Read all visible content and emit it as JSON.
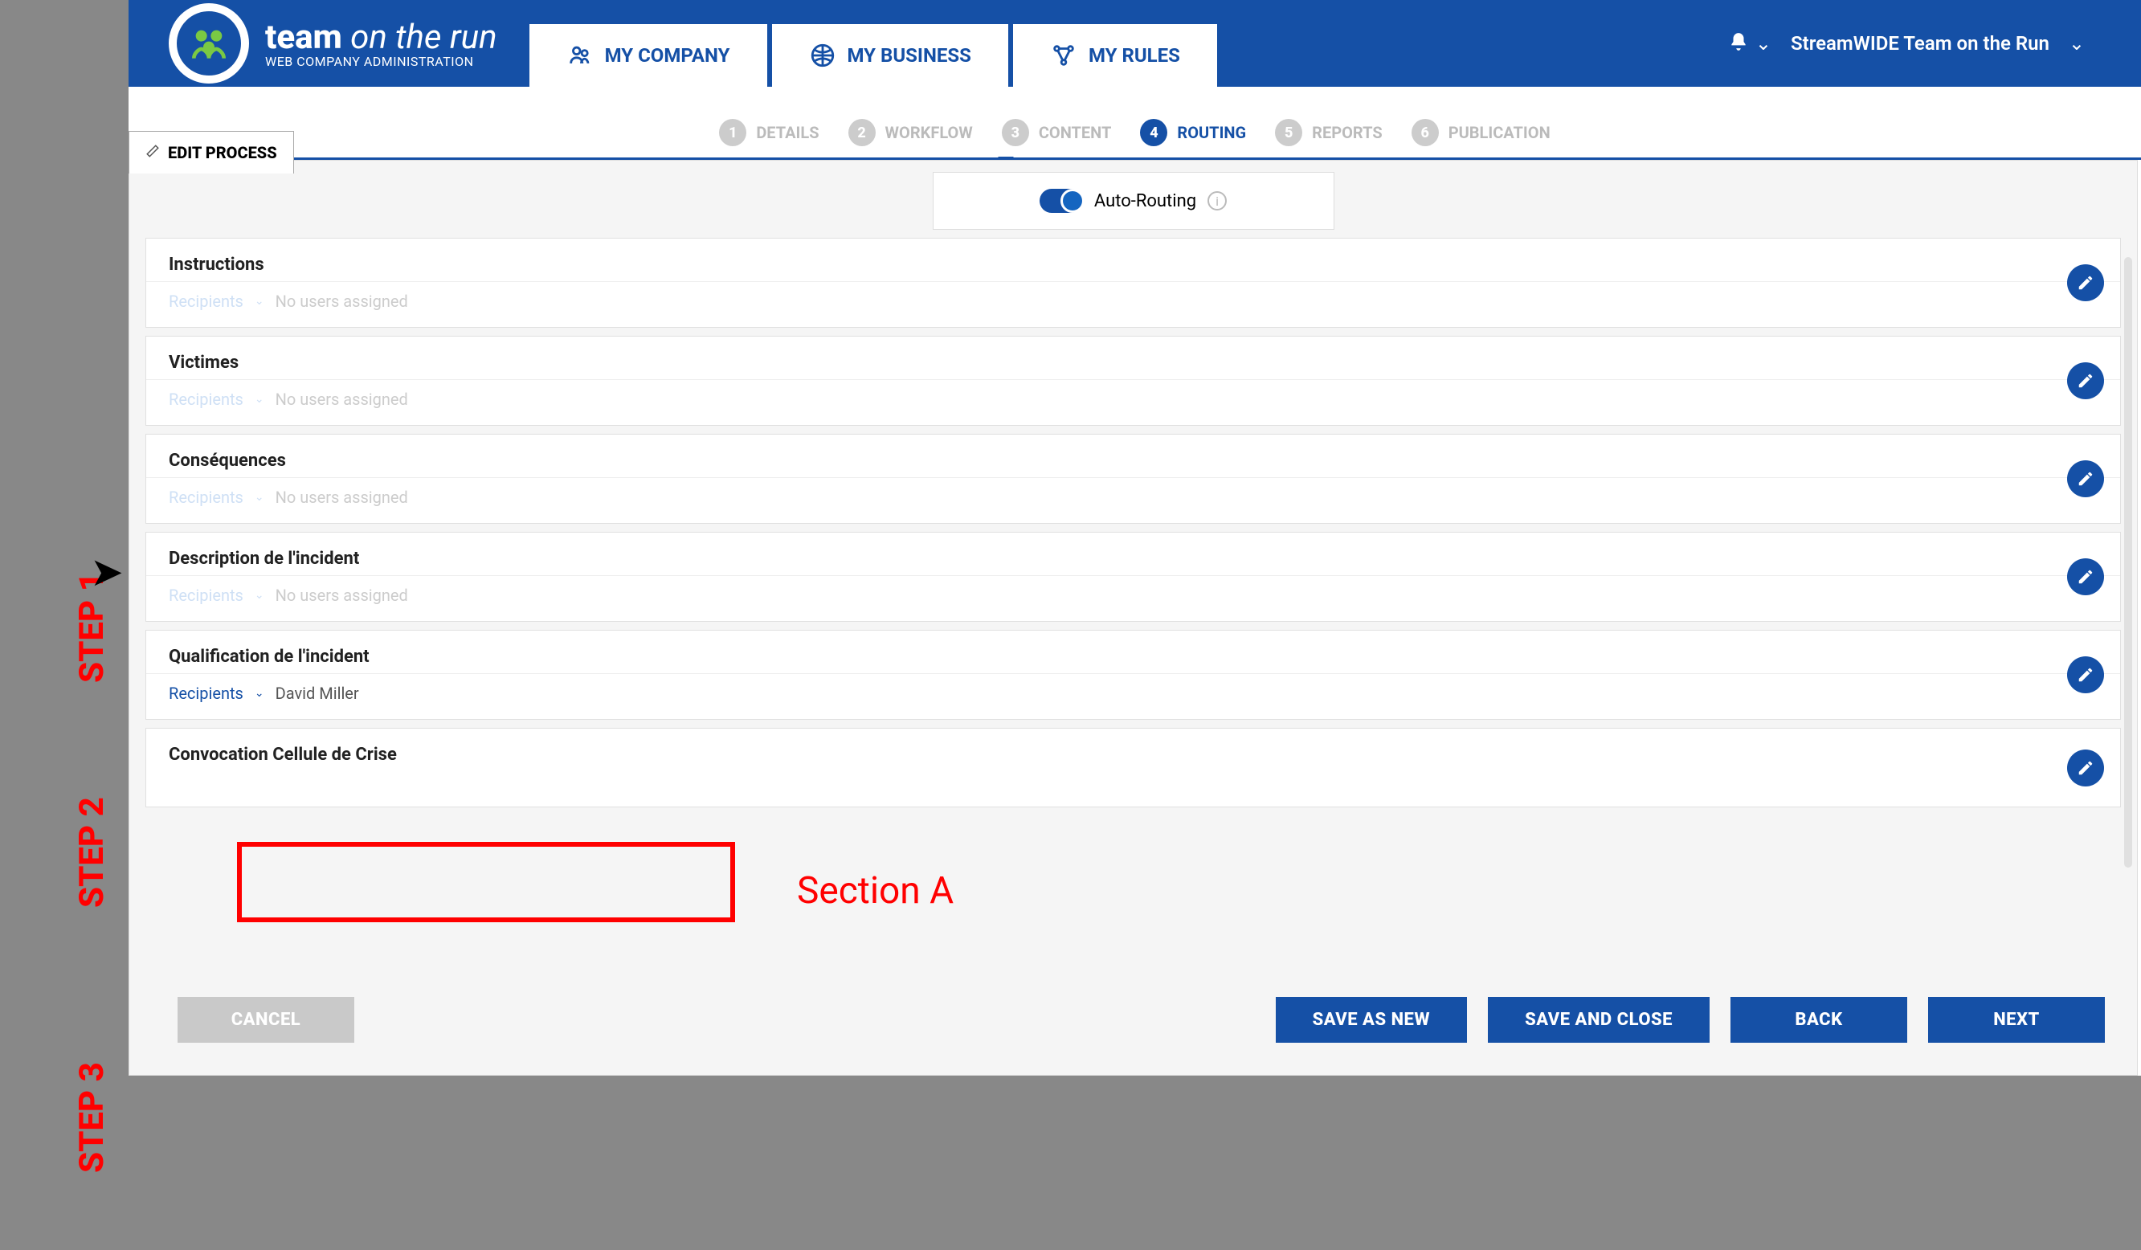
{
  "brand": {
    "title_bold": "team",
    "title_rest": " on the run",
    "subtitle": "WEB COMPANY ADMINISTRATION"
  },
  "nav": {
    "tabs": [
      "MY COMPANY",
      "MY BUSINESS",
      "MY RULES"
    ]
  },
  "user": {
    "company": "StreamWIDE Team on the Run"
  },
  "edit_tab": "EDIT PROCESS",
  "steps": [
    {
      "num": "1",
      "label": "DETAILS"
    },
    {
      "num": "2",
      "label": "WORKFLOW"
    },
    {
      "num": "3",
      "label": "CONTENT"
    },
    {
      "num": "4",
      "label": "ROUTING"
    },
    {
      "num": "5",
      "label": "REPORTS"
    },
    {
      "num": "6",
      "label": "PUBLICATION"
    }
  ],
  "active_step": 4,
  "auto_routing_label": "Auto-Routing",
  "recipients_label": "Recipients",
  "no_users": "No users assigned",
  "cards": [
    {
      "title": "Instructions",
      "value": "No users assigned",
      "active": false
    },
    {
      "title": "Victimes",
      "value": "No users assigned",
      "active": false
    },
    {
      "title": "Conséquences",
      "value": "No users assigned",
      "active": false
    },
    {
      "title": "Description de l'incident",
      "value": "No users assigned",
      "active": false
    },
    {
      "title": "Qualification de l'incident",
      "value": "David Miller",
      "active": true
    },
    {
      "title": "Convocation Cellule de Crise",
      "value": "",
      "active": false
    }
  ],
  "buttons": {
    "cancel": "CANCEL",
    "save_new": "SAVE AS NEW",
    "save_close": "SAVE AND CLOSE",
    "back": "BACK",
    "next": "NEXT"
  },
  "annotations": {
    "step1": "STEP 1",
    "step2": "STEP 2",
    "step3": "STEP 3",
    "section_a": "Section A"
  }
}
